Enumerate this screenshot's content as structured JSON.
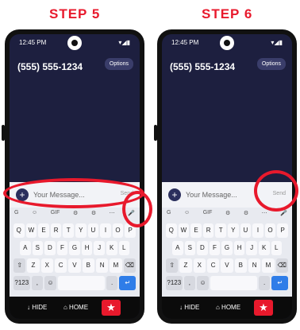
{
  "steps": [
    {
      "title": "STEP 5",
      "status": {
        "time": "12:45 PM",
        "icons": "▾◢▮"
      },
      "header": {
        "phone_number": "(555) 555-1234",
        "options_label": "Options"
      },
      "compose": {
        "plus_label": "+",
        "placeholder": "Your Message...",
        "send_label": "Send"
      },
      "keyboard": {
        "suggestions": [
          "G",
          "☺",
          "GIF",
          "⚙",
          "⚙",
          "⋯",
          "🎤"
        ],
        "rows": [
          [
            "Q",
            "W",
            "E",
            "R",
            "T",
            "Y",
            "U",
            "I",
            "O",
            "P"
          ],
          [
            "A",
            "S",
            "D",
            "F",
            "G",
            "H",
            "J",
            "K",
            "L"
          ],
          [
            "⇧",
            "Z",
            "X",
            "C",
            "V",
            "B",
            "N",
            "M",
            "⌫"
          ],
          [
            "?123",
            ",",
            "☺",
            "",
            "",
            "",
            "",
            ".",
            "↵"
          ]
        ]
      },
      "bottom": {
        "hide_label": "↓ HIDE",
        "home_label": "⌂ HOME",
        "star_label": "★"
      }
    },
    {
      "title": "STEP 6",
      "status": {
        "time": "12:45 PM",
        "icons": "▾◢▮"
      },
      "header": {
        "phone_number": "(555) 555-1234",
        "options_label": "Options"
      },
      "compose": {
        "plus_label": "+",
        "placeholder": "Your Message...",
        "send_label": "Send"
      },
      "keyboard": {
        "suggestions": [
          "G",
          "☺",
          "GIF",
          "⚙",
          "⚙",
          "⋯",
          "🎤"
        ],
        "rows": [
          [
            "Q",
            "W",
            "E",
            "R",
            "T",
            "Y",
            "U",
            "I",
            "O",
            "P"
          ],
          [
            "A",
            "S",
            "D",
            "F",
            "G",
            "H",
            "J",
            "K",
            "L"
          ],
          [
            "⇧",
            "Z",
            "X",
            "C",
            "V",
            "B",
            "N",
            "M",
            "⌫"
          ],
          [
            "?123",
            ",",
            "☺",
            "",
            "",
            "",
            "",
            ".",
            "↵"
          ]
        ]
      },
      "bottom": {
        "hide_label": "↓ HIDE",
        "home_label": "⌂ HOME",
        "star_label": "★"
      }
    }
  ],
  "colors": {
    "accent": "#e8192c",
    "screen_bg": "#1d1f3f",
    "compose_bg": "#f2f3f7",
    "enter_key": "#2f7de8"
  }
}
